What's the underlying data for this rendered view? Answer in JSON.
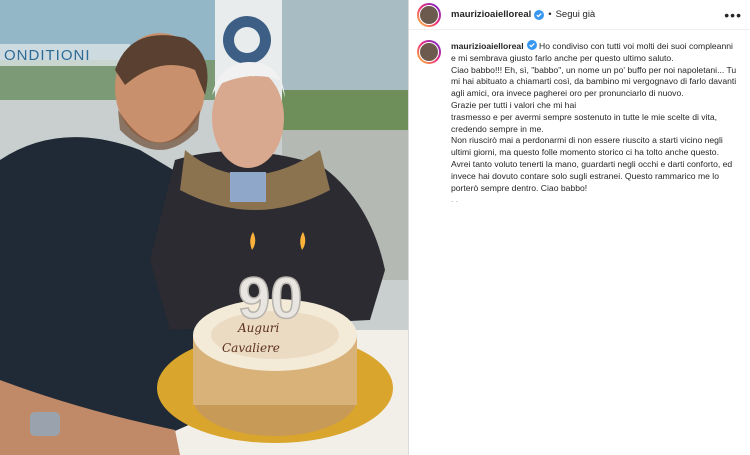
{
  "post": {
    "username": "maurizioaielloreal",
    "follow_label": "Segui già",
    "separator": "•",
    "more_label": "•••",
    "photo_text": {
      "storefront_sign": "ONDITIONI",
      "candle_number": "90",
      "cake_inscription_line1": "Auguri",
      "cake_inscription_line2": "Cavaliere"
    },
    "caption": [
      "Ho condiviso con tutti voi molti dei suoi compleanni e mi sembrava giusto farlo anche per questo ultimo saluto.",
      "Ciao babbo!!! Eh, sì, \"babbo\", un nome un po' buffo per noi napoletani... Tu mi hai abituato a chiamarti così, da bambino mi vergognavo di farlo davanti agli amici, ora invece pagherei oro per pronunciarlo di nuovo.",
      "Grazie per tutti i valori che mi hai",
      "trasmesso e per avermi sempre sostenuto in tutte le mie scelte di vita, credendo sempre in me.",
      "Non riuscirò mai a perdonarmi di non essere riuscito a starti vicino negli ultimi giorni, ma questo folle momento storico ci ha tolto anche questo. Avrei tanto voluto tenerti la mano, guardarti negli occhi e darti conforto, ed invece hai dovuto contare solo sugli estranei. Questo rammarico me lo porterò sempre dentro. Ciao babbo!"
    ],
    "caption_tail": ". ."
  },
  "colors": {
    "verified_blue": "#3897f0",
    "text": "#262626"
  }
}
